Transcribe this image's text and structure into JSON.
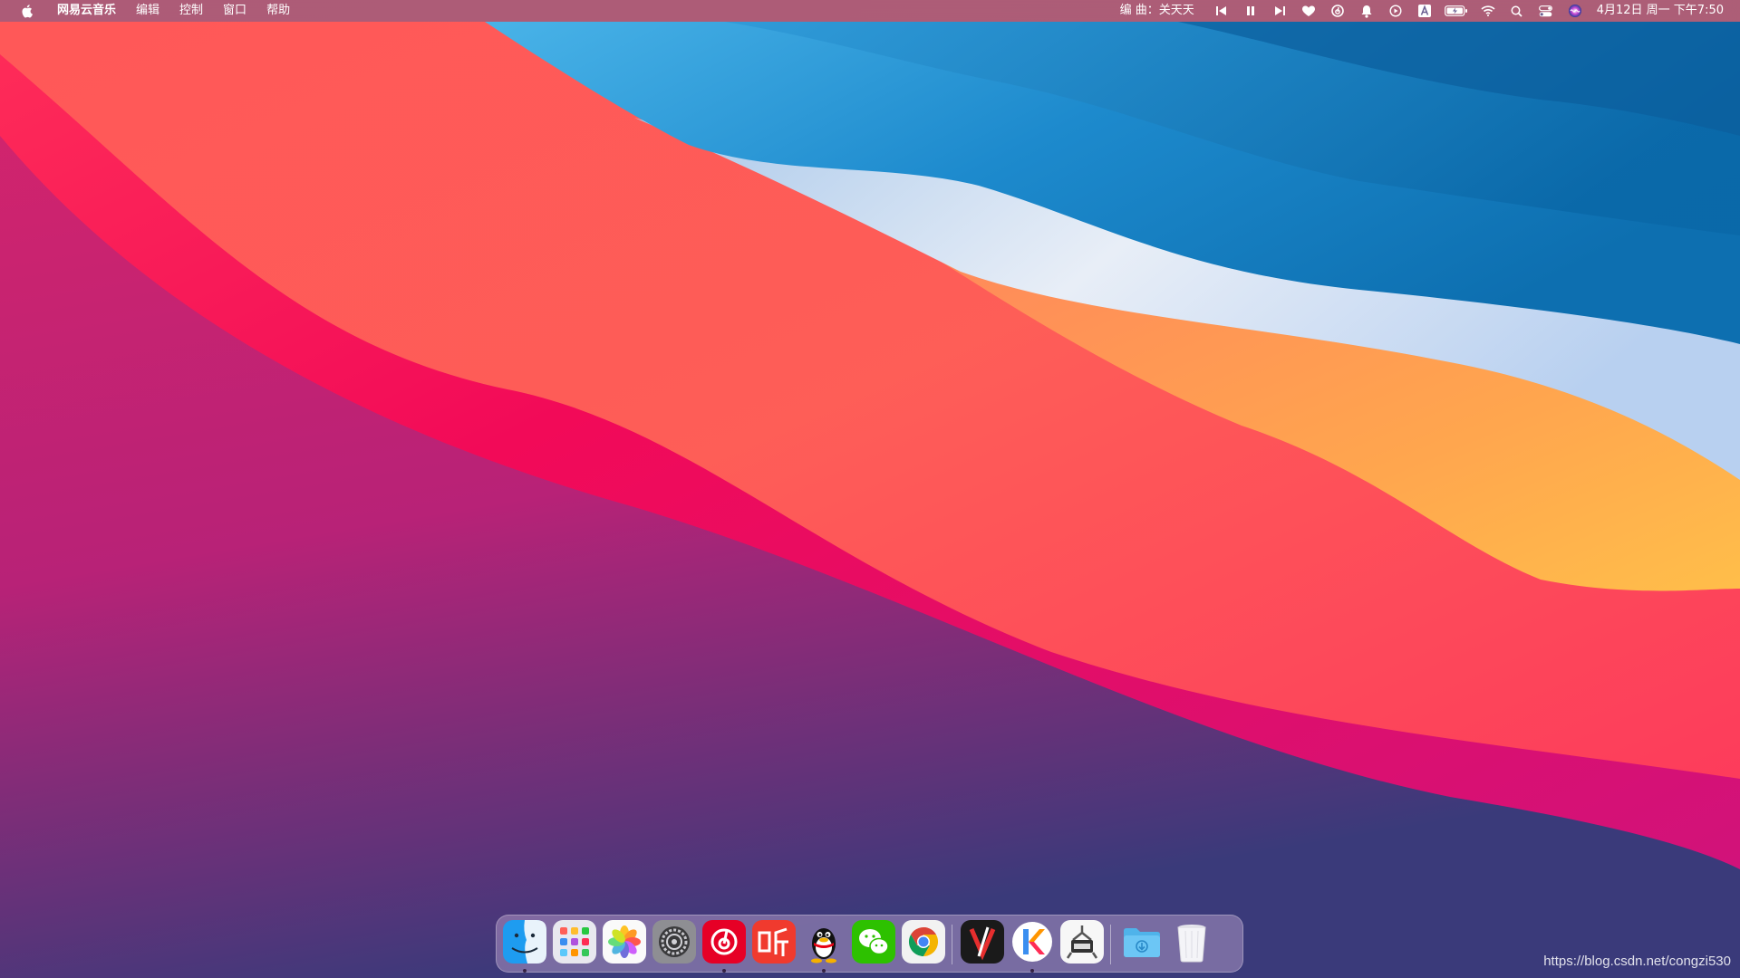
{
  "menubar": {
    "app_name": "网易云音乐",
    "menus": [
      "编辑",
      "控制",
      "窗口",
      "帮助"
    ],
    "now_playing": "编 曲：关天天",
    "clock": "4月12日 周一 下午7:50",
    "status_icons": [
      "previous-track-icon",
      "pause-icon",
      "next-track-icon",
      "heart-icon",
      "netease-status-icon",
      "bell-icon",
      "play-circle-icon",
      "input-method-icon",
      "battery-icon",
      "wifi-icon",
      "spotlight-icon",
      "control-center-icon",
      "siri-icon"
    ]
  },
  "dock": {
    "apps": [
      "finder",
      "launchpad",
      "photos",
      "system-preferences",
      "netease-music",
      "ting",
      "qq",
      "wechat",
      "chrome",
      "xmind",
      "keynote-like",
      "scraper-app",
      "downloads-folder",
      "trash"
    ],
    "running": [
      "finder",
      "netease-music",
      "qq",
      "keynote-like"
    ]
  },
  "watermark": "https://blog.csdn.net/congzi530",
  "colors": {
    "accent_red": "#ff0a4a",
    "accent_orange": "#ffaa4c",
    "accent_blue": "#1a84c8"
  }
}
